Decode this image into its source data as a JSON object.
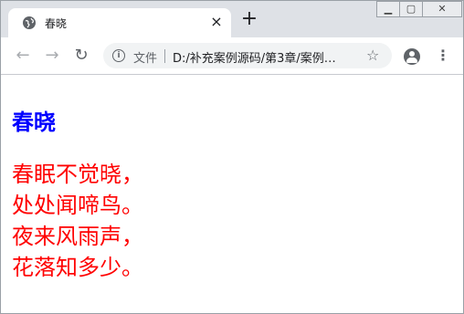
{
  "tab": {
    "title": "春晓",
    "close_glyph": "×"
  },
  "new_tab_glyph": "+",
  "window_controls": {
    "minimize": "▁",
    "maximize": "▢",
    "close": "✕"
  },
  "toolbar": {
    "back_glyph": "←",
    "forward_glyph": "→",
    "reload_glyph": "↻",
    "info_glyph": "i",
    "scheme_label": "文件",
    "url": "D:/补充案例源码/第3章/案例…",
    "star_glyph": "☆",
    "menu_glyph": "⋮"
  },
  "page": {
    "heading": "春晓",
    "poem_lines": [
      "春眠不觉晓，",
      "处处闻啼鸟。",
      "夜来风雨声，",
      "花落知多少。"
    ]
  },
  "colors": {
    "heading": "#0000ff",
    "poem": "#ff0000"
  }
}
